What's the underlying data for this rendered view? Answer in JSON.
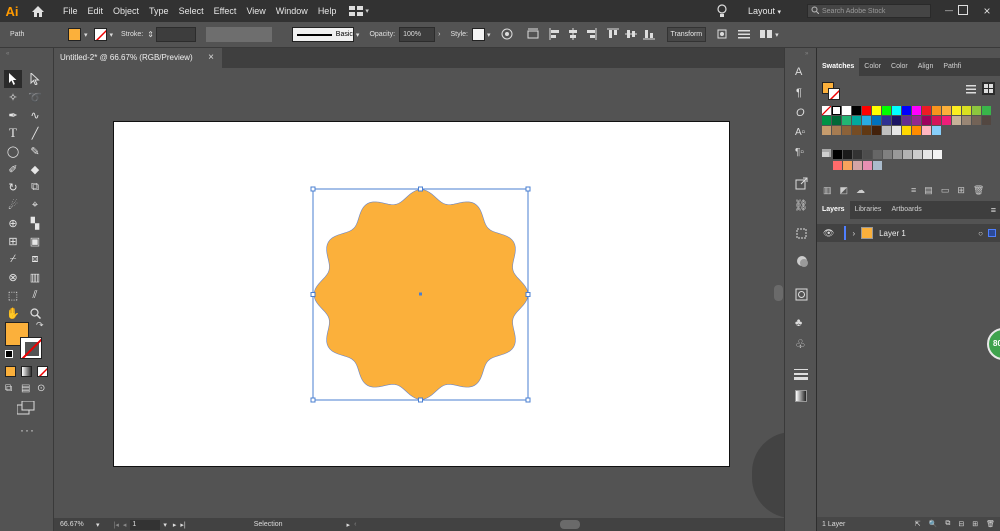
{
  "app": {
    "logo": "Ai"
  },
  "menu": [
    "File",
    "Edit",
    "Object",
    "Type",
    "Select",
    "Effect",
    "View",
    "Window",
    "Help"
  ],
  "top_right": {
    "layout_label": "Layout",
    "search_placeholder": "Search Adobe Stock"
  },
  "control": {
    "object_type": "Path",
    "stroke_label": "Stroke:",
    "brush_label": "Basic",
    "opacity_label": "Opacity:",
    "opacity_value": "100%",
    "style_label": "Style:",
    "transform_label": "Transform"
  },
  "document": {
    "tab_title": "Untitled-2* @ 66.67% (RGB/Preview)",
    "close_glyph": "×"
  },
  "status": {
    "zoom": "66.67%",
    "artboard_number": "1",
    "tool_name": "Selection"
  },
  "swatches_panel": {
    "tabs": [
      "Swatches",
      "Color",
      "Color",
      "Align",
      "Pathfi"
    ]
  },
  "layers_panel": {
    "tabs": [
      "Layers",
      "Libraries",
      "Artboards"
    ],
    "layer_name": "Layer 1",
    "footer": "1 Layer"
  },
  "badge": {
    "text": "80"
  },
  "colors": {
    "fill": "#fbb03b",
    "selection": "#4a7fd1",
    "menubar": "#323232",
    "ui": "#535353"
  },
  "swatch_rows": [
    [
      "#ffffff",
      "#000000",
      "#ff0000",
      "#ffff00",
      "#00ff00",
      "#00ffff",
      "#0000ff",
      "#ff00ff",
      "#ed1c24",
      "#f7941d",
      "#fbb03b",
      "#fcee21"
    ],
    [
      "#d9e021",
      "#8cc63f",
      "#39b54a",
      "#009245",
      "#006837",
      "#22b573",
      "#00a99d",
      "#29abe2",
      "#0071bc",
      "#2e3192",
      "#1b1464",
      "#662d91"
    ],
    [
      "#93278f",
      "#9e005d",
      "#d4145a",
      "#ed1e79",
      "#c7b299",
      "#998675",
      "#736357",
      "#534741",
      "#c69c6d",
      "#a67c52",
      "#8c6239",
      "#754c24"
    ],
    [
      "#603813",
      "#42210b",
      "#bfbfbf",
      "#e6e6e6",
      "#ffd700",
      "#ff8c00",
      "#ffb6c1",
      "#87cefa"
    ]
  ],
  "gray_row": [
    "#000000",
    "#1a1a1a",
    "#333333",
    "#4d4d4d",
    "#666666",
    "#808080",
    "#999999",
    "#b3b3b3",
    "#cccccc",
    "#e6e6e6",
    "#f2f2f2"
  ],
  "misc_row": [
    "#ff6b6b",
    "#f7a35c",
    "#d4a5a5",
    "#e88fb3",
    "#aabbcc"
  ]
}
